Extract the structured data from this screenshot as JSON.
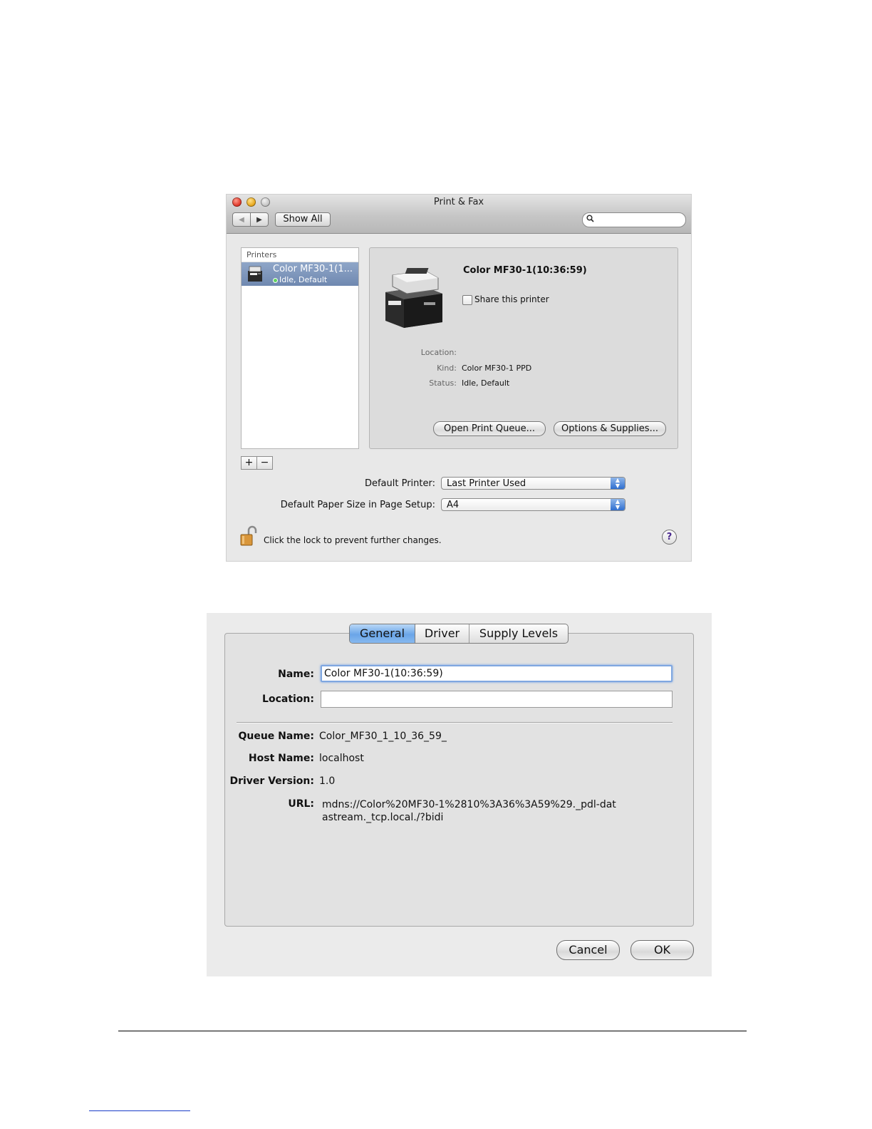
{
  "window": {
    "title": "Print & Fax",
    "show_all_label": "Show All",
    "search_placeholder": ""
  },
  "printer_list": {
    "header": "Printers",
    "items": [
      {
        "name": "Color MF30-1(1...",
        "status": "Idle, Default"
      }
    ],
    "add_label": "+",
    "remove_label": "−"
  },
  "detail": {
    "printer_name": "Color MF30-1(10:36:59)",
    "share_label": "Share this printer",
    "share_checked": false,
    "location_label": "Location:",
    "location_value": "",
    "kind_label": "Kind:",
    "kind_value": "Color MF30-1 PPD",
    "status_label": "Status:",
    "status_value": "Idle, Default",
    "open_queue_label": "Open Print Queue...",
    "options_label": "Options & Supplies..."
  },
  "defaults": {
    "default_printer_label": "Default Printer:",
    "default_printer_value": "Last Printer Used",
    "paper_size_label": "Default Paper Size in Page Setup:",
    "paper_size_value": "A4"
  },
  "lock": {
    "text": "Click the lock to prevent further changes."
  },
  "help": {
    "label": "?"
  },
  "sheet": {
    "tabs": [
      {
        "label": "General",
        "selected": true
      },
      {
        "label": "Driver",
        "selected": false
      },
      {
        "label": "Supply Levels",
        "selected": false
      }
    ],
    "name_label": "Name:",
    "name_value": "Color MF30-1(10:36:59)",
    "location_label": "Location:",
    "location_value": "",
    "queue_name_label": "Queue Name:",
    "queue_name_value": "Color_MF30_1_10_36_59_",
    "host_name_label": "Host Name:",
    "host_name_value": "localhost",
    "driver_version_label": "Driver Version:",
    "driver_version_value": "1.0",
    "url_label": "URL:",
    "url_value": "mdns://Color%20MF30-1%2810%3A36%3A59%29._pdl-datastream._tcp.local./?bidi",
    "cancel_label": "Cancel",
    "ok_label": "OK"
  },
  "colors": {
    "selection": "#6f88b0",
    "accent_blue": "#2f6fd0"
  }
}
